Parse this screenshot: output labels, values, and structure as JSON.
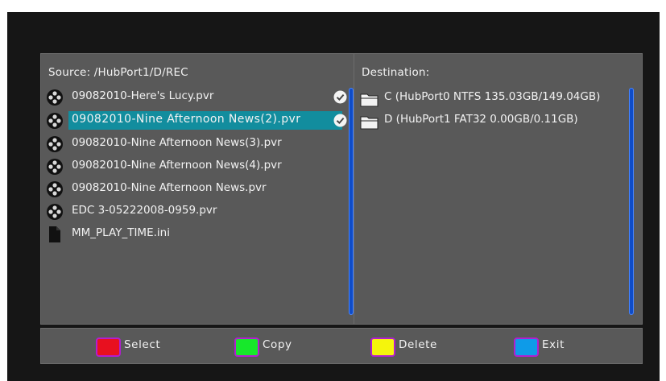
{
  "source": {
    "title": "Source: /HubPort1/D/REC",
    "files": [
      {
        "name": "09082010-Here's Lucy.pvr",
        "icon": "film-reel-icon",
        "checked": true,
        "selected": false
      },
      {
        "name": "09082010-Nine Afternoon News(2).pvr",
        "icon": "film-reel-icon",
        "checked": true,
        "selected": true
      },
      {
        "name": "09082010-Nine Afternoon News(3).pvr",
        "icon": "film-reel-icon",
        "checked": false,
        "selected": false
      },
      {
        "name": "09082010-Nine Afternoon News(4).pvr",
        "icon": "film-reel-icon",
        "checked": false,
        "selected": false
      },
      {
        "name": "09082010-Nine Afternoon News.pvr",
        "icon": "film-reel-icon",
        "checked": false,
        "selected": false
      },
      {
        "name": "EDC 3-05222008-0959.pvr",
        "icon": "film-reel-icon",
        "checked": false,
        "selected": false
      },
      {
        "name": "MM_PLAY_TIME.ini",
        "icon": "document-icon",
        "checked": false,
        "selected": false
      }
    ]
  },
  "destination": {
    "title": "Destination:",
    "drives": [
      {
        "name": "C (HubPort0 NTFS 135.03GB/149.04GB)",
        "icon": "folder-icon"
      },
      {
        "name": "D (HubPort1 FAT32 0.00GB/0.11GB)",
        "icon": "folder-icon"
      }
    ]
  },
  "buttons": [
    {
      "label": "Select",
      "color": "#e8101f"
    },
    {
      "label": "Copy",
      "color": "#17e82b"
    },
    {
      "label": "Delete",
      "color": "#f5f50c"
    },
    {
      "label": "Exit",
      "color": "#0e9be8"
    }
  ],
  "colors": {
    "selection": "#128d9e",
    "scrollbar": "#0f4cc8",
    "key_border": "#b21ecf"
  }
}
